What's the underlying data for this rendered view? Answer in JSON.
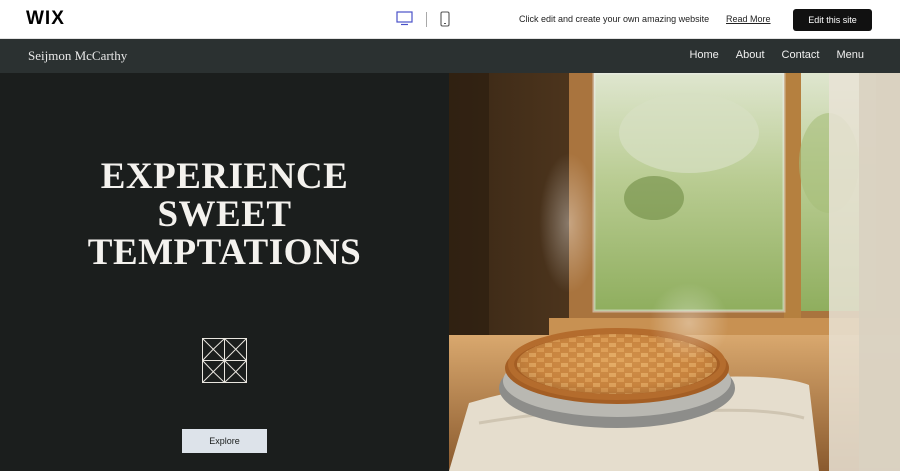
{
  "wix_bar": {
    "logo": "WIX",
    "promo_text": "Click edit and create your own amazing website",
    "read_more": "Read More",
    "edit_button": "Edit this site",
    "desktop_icon": "desktop-icon",
    "mobile_icon": "mobile-icon"
  },
  "site": {
    "title": "Seijmon McCarthy",
    "nav": [
      "Home",
      "About",
      "Contact",
      "Menu"
    ]
  },
  "hero": {
    "headline": [
      "EXPERIENCE",
      "SWEET",
      "TEMPTATIONS"
    ],
    "emblem_icon": "geometric-emblem-icon",
    "explore_button": "Explore",
    "image_subject": "lattice pie on windowsill"
  },
  "colors": {
    "header_bg": "#2b3131",
    "hero_bg": "#1b1e1d",
    "button_bg": "#dde3ea",
    "edit_button_bg": "#111111"
  }
}
